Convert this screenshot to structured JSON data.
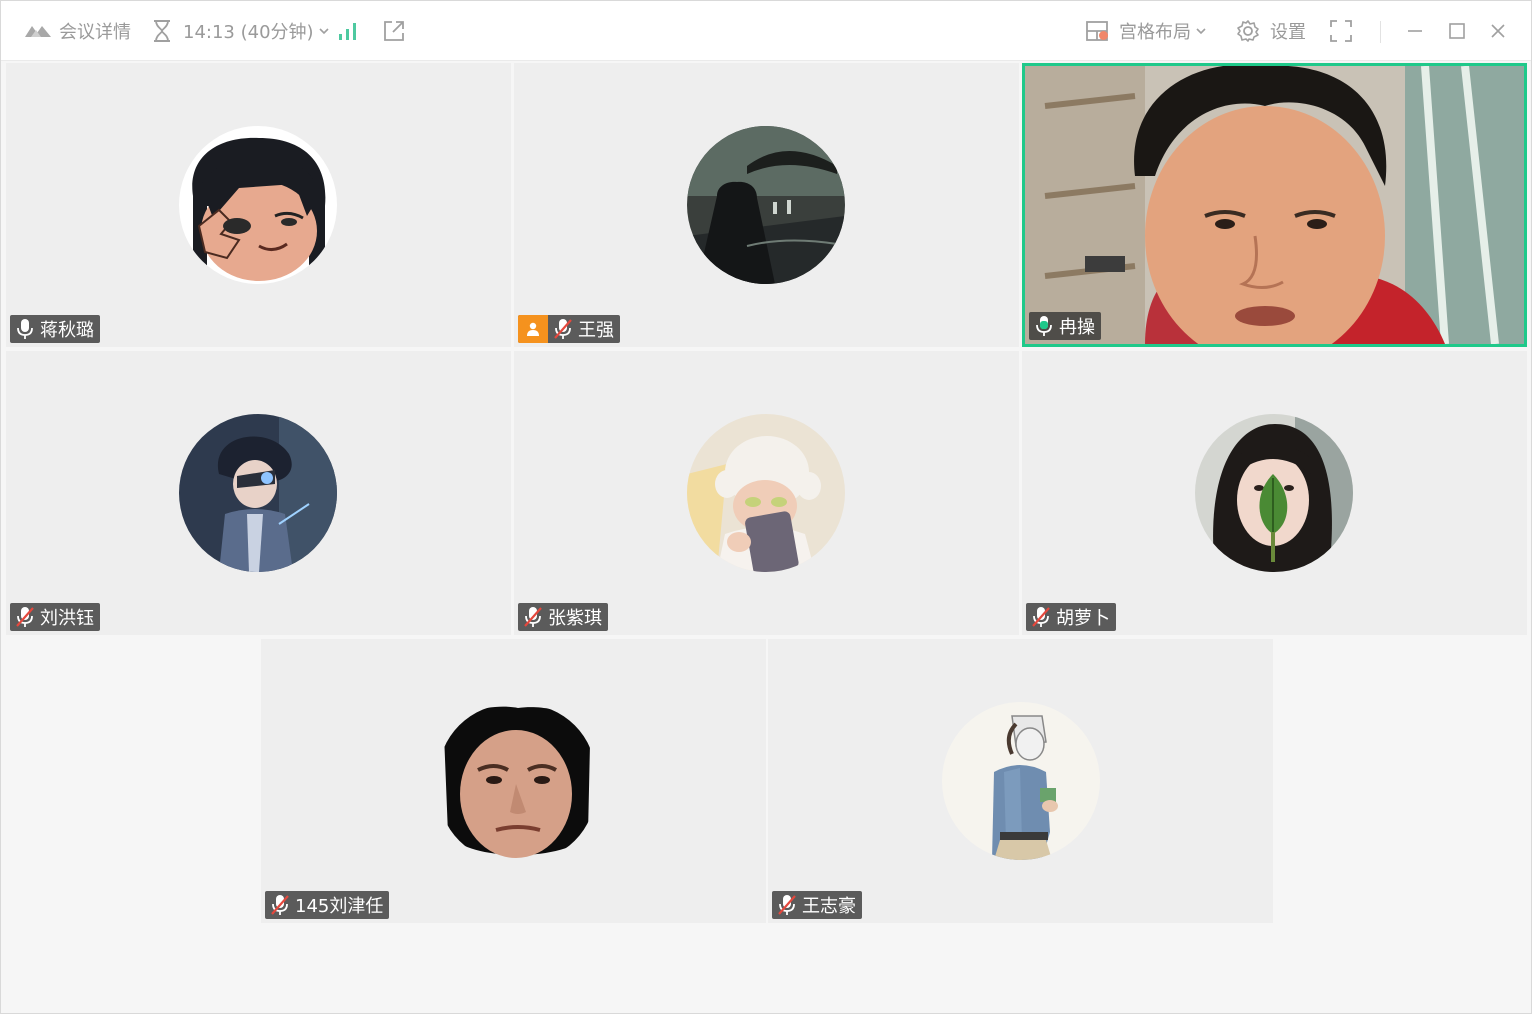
{
  "titlebar": {
    "meeting_details_label": "会议详情",
    "time_label": "14:13 (40分钟)",
    "layout_label": "宫格布局",
    "settings_label": "设置"
  },
  "colors": {
    "accent_green": "#1fc98a",
    "host_orange": "#f5921e",
    "muted_red": "#e5483d",
    "signal_green": "#4ec9a0",
    "badge_orange": "#f0876a"
  },
  "participants": [
    {
      "name": "蒋秋璐",
      "mic": "on",
      "host": false,
      "video": false
    },
    {
      "name": "王强",
      "mic": "muted",
      "host": true,
      "video": false
    },
    {
      "name": "冉操",
      "mic": "speaking",
      "host": false,
      "video": true
    },
    {
      "name": "刘洪钰",
      "mic": "muted",
      "host": false,
      "video": false
    },
    {
      "name": "张紫琪",
      "mic": "muted",
      "host": false,
      "video": false
    },
    {
      "name": "胡萝卜",
      "mic": "muted",
      "host": false,
      "video": false
    },
    {
      "name": "145刘津任",
      "mic": "muted",
      "host": false,
      "video": false
    },
    {
      "name": "王志豪",
      "mic": "muted",
      "host": false,
      "video": false
    }
  ]
}
